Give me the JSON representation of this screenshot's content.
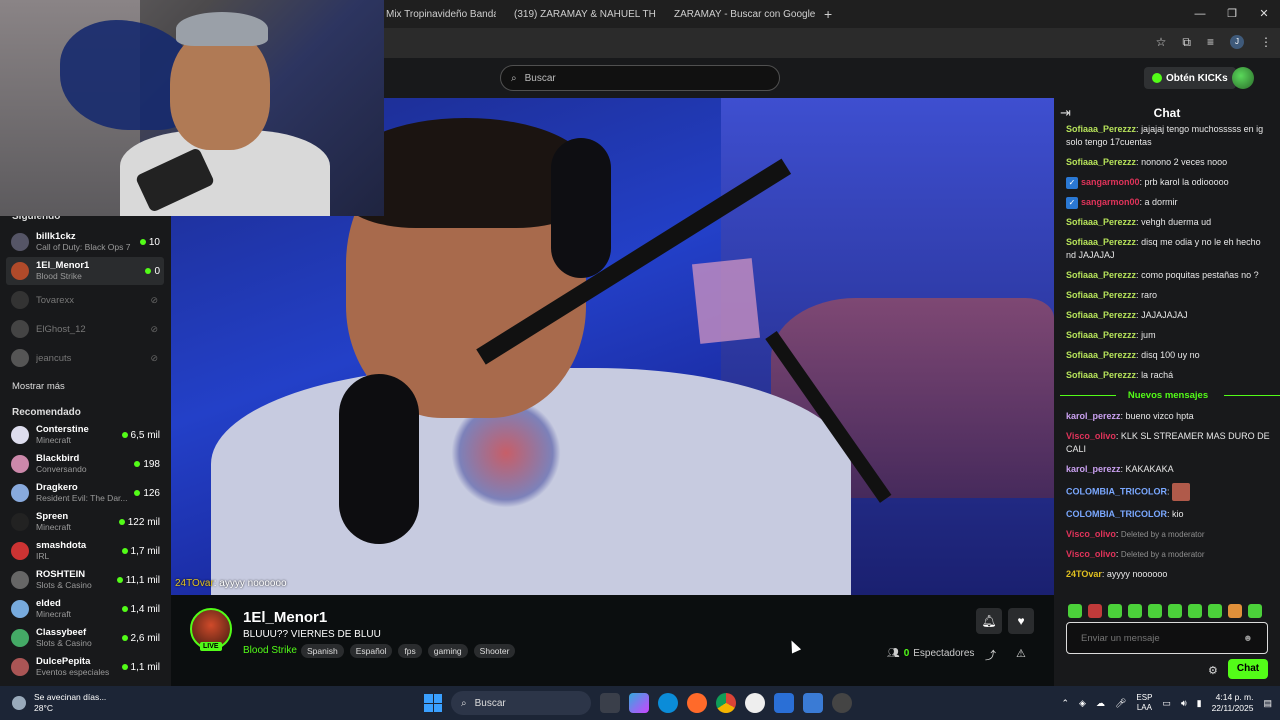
{
  "browser": {
    "tabs": [
      {
        "label": "Mix Tropinavideño Banda",
        "favicon_color": "#2a7cff"
      },
      {
        "label": "(319) ZARAMAY & NAHUEL TH",
        "favicon_color": "#ff0033"
      },
      {
        "label": "ZARAMAY - Buscar con Google",
        "favicon_color": "#4285f4"
      }
    ],
    "new_tab": "+",
    "profile_initial": "J"
  },
  "header": {
    "search_placeholder": "Buscar",
    "kicks_label": "Obtén KICKs"
  },
  "sidebar": {
    "following_title": "Siguiendo",
    "following": [
      {
        "name": "billk1ckz",
        "game": "Call of Duty: Black Ops 7",
        "viewers": "10",
        "live": true
      },
      {
        "name": "1El_Menor1",
        "game": "Blood Strike",
        "viewers": "0",
        "live": true,
        "active": true
      },
      {
        "name": "Tovarexx",
        "live": false
      },
      {
        "name": "ElGhost_12",
        "live": false
      },
      {
        "name": "jeancuts",
        "live": false
      }
    ],
    "show_more": "Mostrar más",
    "recommended_title": "Recomendado",
    "recommended": [
      {
        "name": "Conterstine",
        "game": "Minecraft",
        "viewers": "6,5 mil"
      },
      {
        "name": "Blackbird",
        "game": "Conversando",
        "viewers": "198"
      },
      {
        "name": "Dragkero",
        "game": "Resident Evil: The Dar...",
        "viewers": "126"
      },
      {
        "name": "Spreen",
        "game": "Minecraft",
        "viewers": "122 mil"
      },
      {
        "name": "smashdota",
        "game": "IRL",
        "viewers": "1,7 mil"
      },
      {
        "name": "ROSHTEIN",
        "game": "Slots & Casino",
        "viewers": "11,1 mil"
      },
      {
        "name": "elded",
        "game": "Minecraft",
        "viewers": "1,4 mil"
      },
      {
        "name": "Classybeef",
        "game": "Slots & Casino",
        "viewers": "2,6 mil"
      },
      {
        "name": "DulcePepita",
        "game": "Eventos especiales",
        "viewers": "1,1 mil"
      }
    ]
  },
  "video": {
    "overlay_user": "24TOvar",
    "overlay_text": ": ayyyy noooooo"
  },
  "stream": {
    "live_label": "LIVE",
    "streamer": "1El_Menor1",
    "title": "BLUUU?? VIERNES DE BLUU",
    "category": "Blood Strike",
    "tags": [
      "Spanish",
      "Español",
      "fps",
      "gaming",
      "Shooter"
    ],
    "viewer_count": "0",
    "viewer_label": "Espectadores"
  },
  "chat": {
    "title": "Chat",
    "new_messages_label": "Nuevos mensajes",
    "messages_before": [
      {
        "user": "Sofiaaa_Perezzz",
        "color": "#b6e25a",
        "text": "jajajaj tengo muchosssss en ig solo tengo 17cuentas"
      },
      {
        "user": "Sofiaaa_Perezzz",
        "color": "#b6e25a",
        "text": "nonono 2 veces nooo"
      },
      {
        "user": "sangarmon00",
        "color": "#e0335a",
        "text": "prb karol la odiooooo",
        "badge": true
      },
      {
        "user": "sangarmon00",
        "color": "#e0335a",
        "text": "a dormir",
        "badge": true
      },
      {
        "user": "Sofiaaa_Perezzz",
        "color": "#b6e25a",
        "text": "vehgh duerma ud"
      },
      {
        "user": "Sofiaaa_Perezzz",
        "color": "#b6e25a",
        "text": "disq me odia y no le eh hecho nd JAJAJAJ"
      },
      {
        "user": "Sofiaaa_Perezzz",
        "color": "#b6e25a",
        "text": "como poquitas pestañas no ?"
      },
      {
        "user": "Sofiaaa_Perezzz",
        "color": "#b6e25a",
        "text": "raro"
      },
      {
        "user": "Sofiaaa_Perezzz",
        "color": "#b6e25a",
        "text": "JAJAJAJAJ"
      },
      {
        "user": "Sofiaaa_Perezzz",
        "color": "#b6e25a",
        "text": "jum"
      },
      {
        "user": "Sofiaaa_Perezzz",
        "color": "#b6e25a",
        "text": "disq 100 uy no"
      },
      {
        "user": "Sofiaaa_Perezzz",
        "color": "#b6e25a",
        "text": "la rachá"
      }
    ],
    "messages_after": [
      {
        "user": "karol_perezz",
        "color": "#c9a0f0",
        "text": "bueno vizco hpta"
      },
      {
        "user": "Visco_olivo",
        "color": "#e0335a",
        "text": "KLK SL STREAMER MAS DURO DE CALI"
      },
      {
        "user": "karol_perezz",
        "color": "#c9a0f0",
        "text": "KAKAKAKA"
      },
      {
        "user": "COLOMBIA_TRICOLOR",
        "color": "#7aa8ff",
        "text": "",
        "emote": true
      },
      {
        "user": "COLOMBIA_TRICOLOR",
        "color": "#7aa8ff",
        "text": "kio"
      },
      {
        "user": "Visco_olivo",
        "color": "#e0335a",
        "text": "Deleted by a moderator",
        "deleted": true
      },
      {
        "user": "Visco_olivo",
        "color": "#e0335a",
        "text": "Deleted by a moderator",
        "deleted": true
      },
      {
        "user": "24TOvar",
        "color": "#e0c020",
        "text": "ayyyy noooooo"
      }
    ],
    "input_placeholder": "Enviar un mensaje",
    "send_label": "Chat"
  },
  "taskbar": {
    "weather_text": "Se avecinan días...",
    "temperature": "28°C",
    "search_label": "Buscar",
    "language": "ESP",
    "region": "LAA",
    "time": "4:14 p. m.",
    "date": "22/11/2025"
  }
}
